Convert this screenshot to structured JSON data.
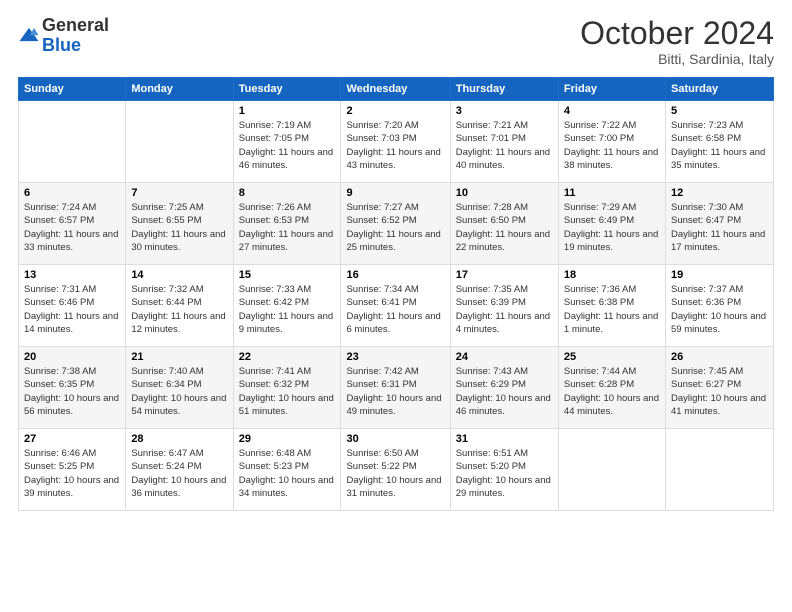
{
  "header": {
    "logo": {
      "general": "General",
      "blue": "Blue"
    },
    "title": "October 2024",
    "subtitle": "Bitti, Sardinia, Italy"
  },
  "weekdays": [
    "Sunday",
    "Monday",
    "Tuesday",
    "Wednesday",
    "Thursday",
    "Friday",
    "Saturday"
  ],
  "weeks": [
    [
      {
        "day": "",
        "info": ""
      },
      {
        "day": "",
        "info": ""
      },
      {
        "day": "1",
        "info": "Sunrise: 7:19 AM\nSunset: 7:05 PM\nDaylight: 11 hours and 46 minutes."
      },
      {
        "day": "2",
        "info": "Sunrise: 7:20 AM\nSunset: 7:03 PM\nDaylight: 11 hours and 43 minutes."
      },
      {
        "day": "3",
        "info": "Sunrise: 7:21 AM\nSunset: 7:01 PM\nDaylight: 11 hours and 40 minutes."
      },
      {
        "day": "4",
        "info": "Sunrise: 7:22 AM\nSunset: 7:00 PM\nDaylight: 11 hours and 38 minutes."
      },
      {
        "day": "5",
        "info": "Sunrise: 7:23 AM\nSunset: 6:58 PM\nDaylight: 11 hours and 35 minutes."
      }
    ],
    [
      {
        "day": "6",
        "info": "Sunrise: 7:24 AM\nSunset: 6:57 PM\nDaylight: 11 hours and 33 minutes."
      },
      {
        "day": "7",
        "info": "Sunrise: 7:25 AM\nSunset: 6:55 PM\nDaylight: 11 hours and 30 minutes."
      },
      {
        "day": "8",
        "info": "Sunrise: 7:26 AM\nSunset: 6:53 PM\nDaylight: 11 hours and 27 minutes."
      },
      {
        "day": "9",
        "info": "Sunrise: 7:27 AM\nSunset: 6:52 PM\nDaylight: 11 hours and 25 minutes."
      },
      {
        "day": "10",
        "info": "Sunrise: 7:28 AM\nSunset: 6:50 PM\nDaylight: 11 hours and 22 minutes."
      },
      {
        "day": "11",
        "info": "Sunrise: 7:29 AM\nSunset: 6:49 PM\nDaylight: 11 hours and 19 minutes."
      },
      {
        "day": "12",
        "info": "Sunrise: 7:30 AM\nSunset: 6:47 PM\nDaylight: 11 hours and 17 minutes."
      }
    ],
    [
      {
        "day": "13",
        "info": "Sunrise: 7:31 AM\nSunset: 6:46 PM\nDaylight: 11 hours and 14 minutes."
      },
      {
        "day": "14",
        "info": "Sunrise: 7:32 AM\nSunset: 6:44 PM\nDaylight: 11 hours and 12 minutes."
      },
      {
        "day": "15",
        "info": "Sunrise: 7:33 AM\nSunset: 6:42 PM\nDaylight: 11 hours and 9 minutes."
      },
      {
        "day": "16",
        "info": "Sunrise: 7:34 AM\nSunset: 6:41 PM\nDaylight: 11 hours and 6 minutes."
      },
      {
        "day": "17",
        "info": "Sunrise: 7:35 AM\nSunset: 6:39 PM\nDaylight: 11 hours and 4 minutes."
      },
      {
        "day": "18",
        "info": "Sunrise: 7:36 AM\nSunset: 6:38 PM\nDaylight: 11 hours and 1 minute."
      },
      {
        "day": "19",
        "info": "Sunrise: 7:37 AM\nSunset: 6:36 PM\nDaylight: 10 hours and 59 minutes."
      }
    ],
    [
      {
        "day": "20",
        "info": "Sunrise: 7:38 AM\nSunset: 6:35 PM\nDaylight: 10 hours and 56 minutes."
      },
      {
        "day": "21",
        "info": "Sunrise: 7:40 AM\nSunset: 6:34 PM\nDaylight: 10 hours and 54 minutes."
      },
      {
        "day": "22",
        "info": "Sunrise: 7:41 AM\nSunset: 6:32 PM\nDaylight: 10 hours and 51 minutes."
      },
      {
        "day": "23",
        "info": "Sunrise: 7:42 AM\nSunset: 6:31 PM\nDaylight: 10 hours and 49 minutes."
      },
      {
        "day": "24",
        "info": "Sunrise: 7:43 AM\nSunset: 6:29 PM\nDaylight: 10 hours and 46 minutes."
      },
      {
        "day": "25",
        "info": "Sunrise: 7:44 AM\nSunset: 6:28 PM\nDaylight: 10 hours and 44 minutes."
      },
      {
        "day": "26",
        "info": "Sunrise: 7:45 AM\nSunset: 6:27 PM\nDaylight: 10 hours and 41 minutes."
      }
    ],
    [
      {
        "day": "27",
        "info": "Sunrise: 6:46 AM\nSunset: 5:25 PM\nDaylight: 10 hours and 39 minutes."
      },
      {
        "day": "28",
        "info": "Sunrise: 6:47 AM\nSunset: 5:24 PM\nDaylight: 10 hours and 36 minutes."
      },
      {
        "day": "29",
        "info": "Sunrise: 6:48 AM\nSunset: 5:23 PM\nDaylight: 10 hours and 34 minutes."
      },
      {
        "day": "30",
        "info": "Sunrise: 6:50 AM\nSunset: 5:22 PM\nDaylight: 10 hours and 31 minutes."
      },
      {
        "day": "31",
        "info": "Sunrise: 6:51 AM\nSunset: 5:20 PM\nDaylight: 10 hours and 29 minutes."
      },
      {
        "day": "",
        "info": ""
      },
      {
        "day": "",
        "info": ""
      }
    ]
  ]
}
